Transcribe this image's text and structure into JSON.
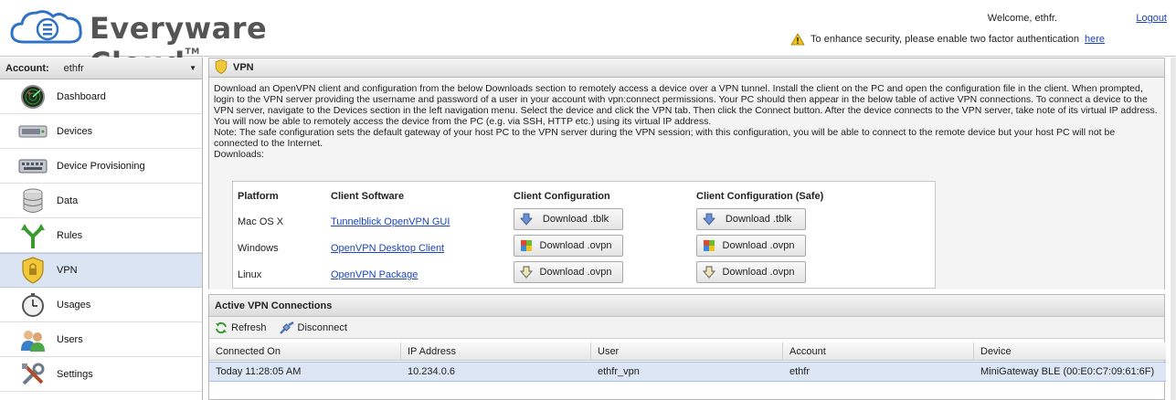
{
  "header": {
    "brand": "Everyware Cloud",
    "tm": "TM",
    "welcome": "Welcome, ethfr.",
    "logout": "Logout",
    "notice_text": "To enhance security, please enable two factor authentication",
    "notice_link": "here"
  },
  "sidebar": {
    "account_label": "Account:",
    "account_value": "ethfr",
    "items": [
      {
        "label": "Dashboard",
        "icon": "radar-icon"
      },
      {
        "label": "Devices",
        "icon": "device-icon"
      },
      {
        "label": "Device Provisioning",
        "icon": "keyboard-device-icon"
      },
      {
        "label": "Data",
        "icon": "database-icon"
      },
      {
        "label": "Rules",
        "icon": "rules-arrows-icon"
      },
      {
        "label": "VPN",
        "icon": "shield-icon"
      },
      {
        "label": "Usages",
        "icon": "stopwatch-icon"
      },
      {
        "label": "Users",
        "icon": "users-icon"
      },
      {
        "label": "Settings",
        "icon": "tools-icon"
      }
    ]
  },
  "vpn": {
    "title": "VPN",
    "para1": "Download an OpenVPN client and configuration from the below Downloads section to remotely access a device over a VPN tunnel. Install the client on the PC and open the configuration file in the client. When prompted, login to the VPN server providing the username and password of a user in your account with vpn:connect permissions. Your PC should then appear in the below table of active VPN connections. To connect a device to the VPN server, navigate to the Devices section in the left navigation menu. Select the device and click the VPN tab. Then click the Connect button. After the device connects to the VPN server, take note of its virtual IP address. You will now be able to remotely access the device from the PC (e.g. via SSH, HTTP etc.) using its virtual IP address.",
    "para2": "Note: The safe configuration sets the default gateway of your host PC to the VPN server during the VPN session; with this configuration, you will be able to connect to the remote device but your host PC will not be connected to the Internet.",
    "downloads_label": "Downloads:",
    "headers": {
      "platform": "Platform",
      "client": "Client Software",
      "config": "Client Configuration",
      "config_safe": "Client Configuration (Safe)"
    },
    "rows": [
      {
        "platform": "Mac OS X",
        "client": "Tunnelblick OpenVPN GUI",
        "config": "Download .tblk",
        "config_safe": "Download .tblk"
      },
      {
        "platform": "Windows",
        "client": "OpenVPN Desktop Client",
        "config": "Download .ovpn",
        "config_safe": "Download .ovpn"
      },
      {
        "platform": "Linux",
        "client": "OpenVPN Package",
        "config": "Download .ovpn",
        "config_safe": "Download .ovpn"
      }
    ]
  },
  "connections": {
    "title": "Active VPN Connections",
    "refresh": "Refresh",
    "disconnect": "Disconnect",
    "columns": [
      "Connected On",
      "IP Address",
      "User",
      "Account",
      "Device"
    ],
    "rows": [
      [
        "Today 11:28:05 AM",
        "10.234.0.6",
        "ethfr_vpn",
        "ethfr",
        "MiniGateway BLE (00:E0:C7:09:61:6F)"
      ]
    ]
  },
  "colors": {
    "link": "#1a44c0",
    "selected_row": "#dde6f4",
    "active_nav": "#dbe4f3"
  }
}
